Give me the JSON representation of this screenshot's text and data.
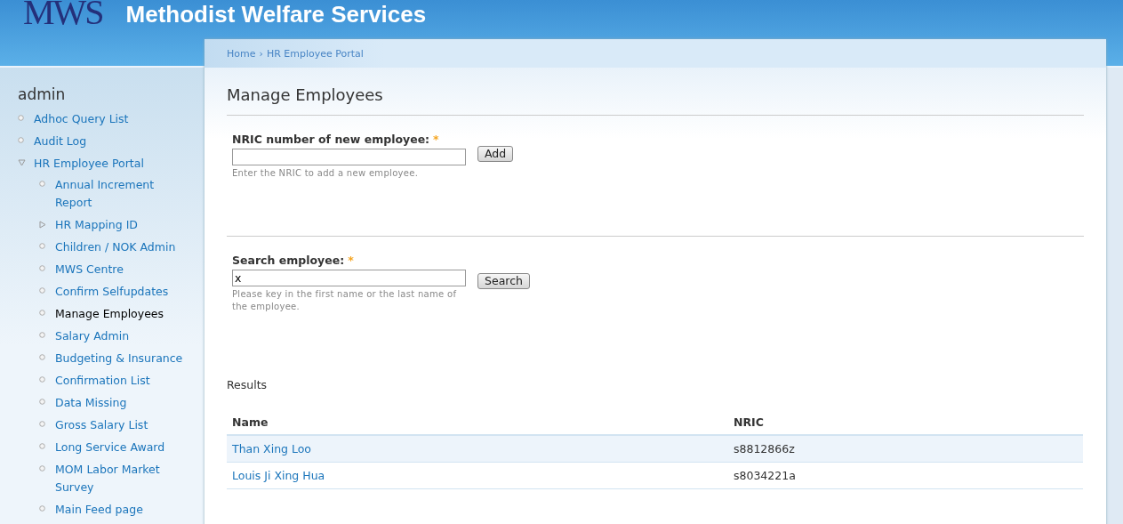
{
  "header": {
    "logo": "MWS",
    "title": "Methodist Welfare Services"
  },
  "breadcrumb": [
    "Home",
    "HR Employee Portal"
  ],
  "breadcrumb_separator": "›",
  "sidebar": {
    "title": "admin",
    "items": [
      {
        "label": "Adhoc Query List",
        "kind": "leaf",
        "selected": false
      },
      {
        "label": "Audit Log",
        "kind": "leaf",
        "selected": false
      },
      {
        "label": "HR Employee Portal",
        "kind": "parent",
        "expanded": true,
        "selected": false,
        "children": [
          {
            "label": "Annual Increment Report",
            "kind": "leaf",
            "selected": false
          },
          {
            "label": "HR Mapping ID",
            "kind": "parent",
            "expanded": false,
            "selected": false
          },
          {
            "label": "Children / NOK Admin",
            "kind": "leaf",
            "selected": false
          },
          {
            "label": "MWS Centre",
            "kind": "leaf",
            "selected": false
          },
          {
            "label": "Confirm Selfupdates",
            "kind": "leaf",
            "selected": false
          },
          {
            "label": "Manage Employees",
            "kind": "leaf",
            "selected": true
          },
          {
            "label": "Salary Admin",
            "kind": "leaf",
            "selected": false
          },
          {
            "label": "Budgeting & Insurance",
            "kind": "leaf",
            "selected": false
          },
          {
            "label": "Confirmation List",
            "kind": "leaf",
            "selected": false
          },
          {
            "label": "Data Missing",
            "kind": "leaf",
            "selected": false
          },
          {
            "label": "Gross Salary List",
            "kind": "leaf",
            "selected": false
          },
          {
            "label": "Long Service Award",
            "kind": "leaf",
            "selected": false
          },
          {
            "label": "MOM Labor Market Survey",
            "kind": "leaf",
            "selected": false
          },
          {
            "label": "Main Feed page",
            "kind": "leaf",
            "selected": false
          }
        ]
      }
    ]
  },
  "page_title": "Manage Employees",
  "forms": [
    {
      "label": "NRIC number of new employee:",
      "required_mark": "*",
      "button": "Add",
      "description": "Enter the NRIC to add a new employee."
    },
    {
      "label": "Search employee:",
      "required_mark": "*",
      "value": "x",
      "button": "Search",
      "description": "Please key in the first name or the last name of the employee."
    }
  ],
  "results": {
    "title": "Results",
    "columns": [
      "Name",
      "NRIC"
    ],
    "rows": [
      [
        "Than Xing Loo",
        "s8812866z"
      ],
      [
        "Louis Ji Xing Hua",
        "s8034221a"
      ]
    ]
  }
}
